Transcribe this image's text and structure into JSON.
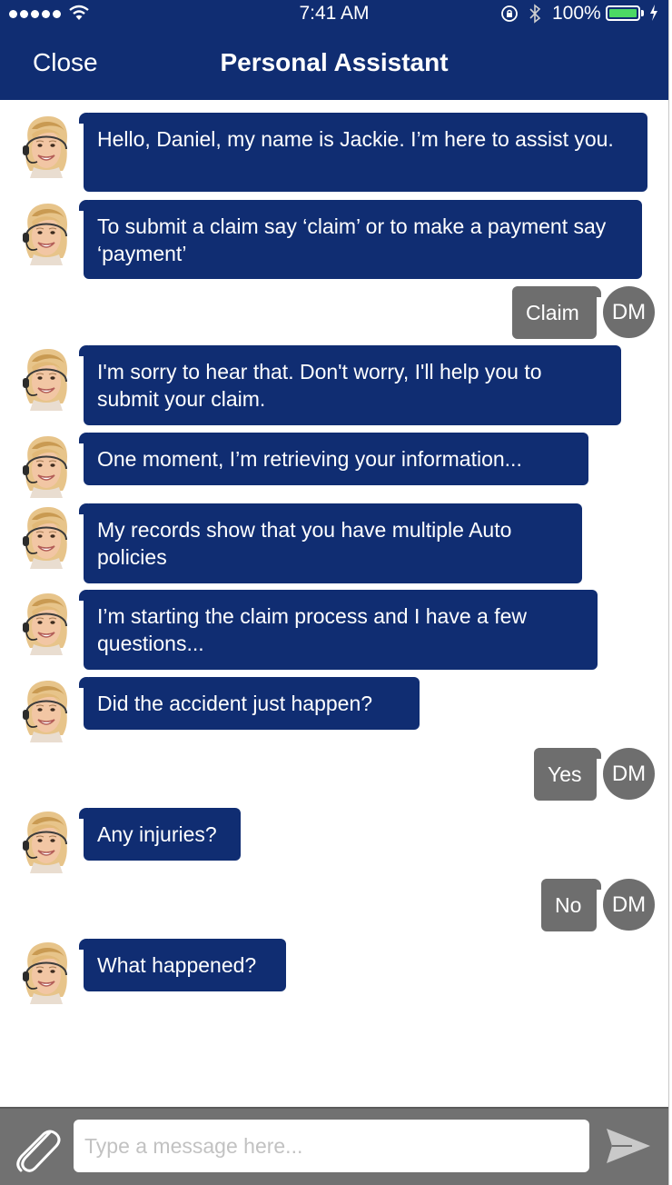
{
  "status_bar": {
    "time": "7:41 AM",
    "battery_percent": "100%",
    "battery_level": 1.0
  },
  "nav": {
    "close_label": "Close",
    "title": "Personal Assistant"
  },
  "messages": [
    {
      "from": "assistant",
      "text": "Hello, Daniel, my name is Jackie. I’m here to assist you."
    },
    {
      "from": "assistant",
      "text": "To submit a claim say ‘claim’ or to make a payment say ‘payment’"
    },
    {
      "from": "user",
      "text": "Claim",
      "initials": "DM"
    },
    {
      "from": "assistant",
      "text": "I'm sorry to hear that. Don't worry, I'll help you to submit your claim."
    },
    {
      "from": "assistant",
      "text": "One moment, I’m retrieving your information..."
    },
    {
      "from": "assistant",
      "text": "My records show that you have multiple Auto policies"
    },
    {
      "from": "assistant",
      "text": "I’m starting the claim process and I have a few questions..."
    },
    {
      "from": "assistant",
      "text": "Did the accident just happen?"
    },
    {
      "from": "user",
      "text": "Yes",
      "initials": "DM"
    },
    {
      "from": "assistant",
      "text": "Any injuries?"
    },
    {
      "from": "user",
      "text": "No",
      "initials": "DM"
    },
    {
      "from": "assistant",
      "text": "What happened?"
    }
  ],
  "composer": {
    "placeholder": "Type a message here..."
  },
  "colors": {
    "brand_navy": "#102d72",
    "user_bubble": "#6e6e6e",
    "composer_bar": "#717171",
    "battery_green": "#4cd964"
  },
  "icons": {
    "attach": "paperclip-icon",
    "send": "send-arrow-icon",
    "assistant_avatar": "assistant-photo-avatar"
  }
}
